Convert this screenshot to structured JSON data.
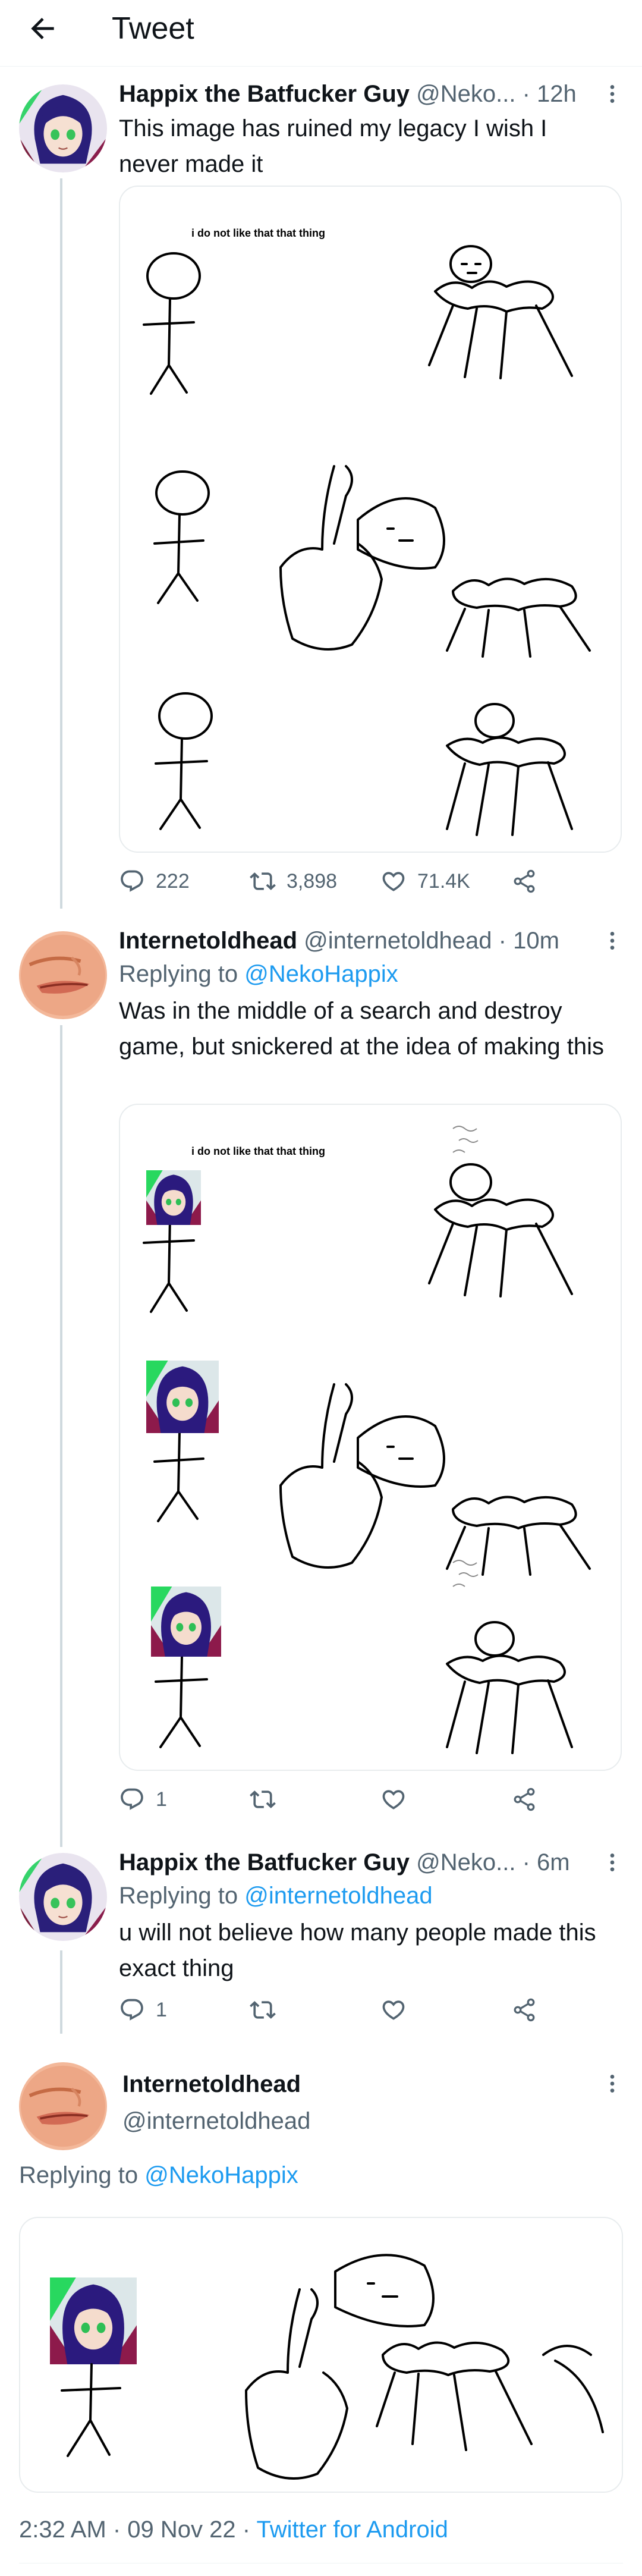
{
  "header": {
    "title": "Tweet"
  },
  "tweets": [
    {
      "name": "Happix the Batfucker Guy",
      "handle": "@Neko...",
      "dot": " · ",
      "time": "12h",
      "text": "This image has ruined my legacy I wish I never made it",
      "media_caption": "i do not like that that thing",
      "stats": {
        "replies": "222",
        "retweets": "3,898",
        "likes": "71.4K"
      }
    },
    {
      "name": "Internetoldhead",
      "handle": "@internetoldhead",
      "dot": " · ",
      "time": "10m",
      "reply_label": "Replying to ",
      "reply_handle": "@NekoHappix",
      "text": "Was in the middle of a search and destroy game, but snickered at the idea of making this",
      "media_caption": "i do not like that that thing",
      "stats": {
        "replies": "1"
      }
    },
    {
      "name": "Happix the Batfucker Guy",
      "handle": "@Neko...",
      "dot": " · ",
      "time": "6m",
      "reply_label": "Replying to ",
      "reply_handle": "@internetoldhead",
      "text": "u will not believe how many people made this exact thing",
      "stats": {
        "replies": "1"
      }
    }
  ],
  "main_tweet": {
    "name": "Internetoldhead",
    "handle": "@internetoldhead",
    "reply_label": "Replying to ",
    "reply_handle": "@NekoHappix",
    "timestamp": "2:32 AM · 09 Nov 22 · ",
    "source": "Twitter for Android"
  },
  "colors": {
    "accent": "#1d9bf0",
    "secondary_text": "#536471",
    "divider": "#eff3f4"
  }
}
